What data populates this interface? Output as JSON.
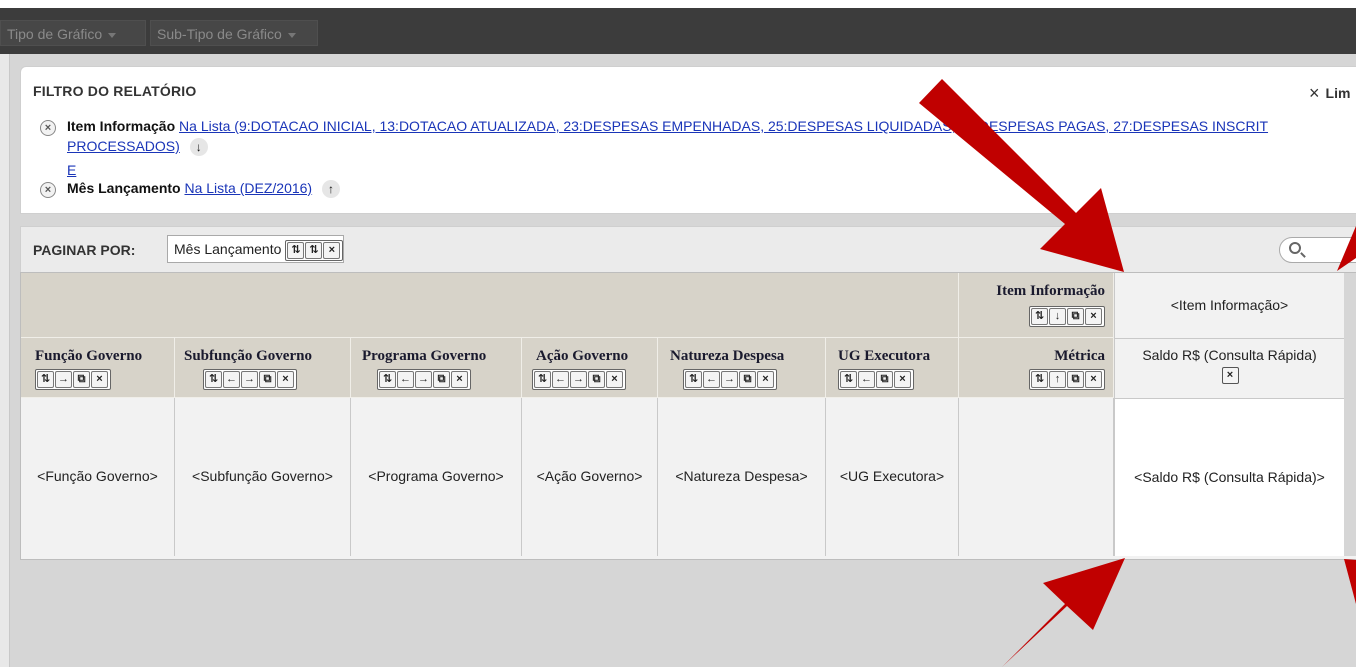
{
  "toolbar": {
    "chart_type": "Tipo de Gráfico",
    "chart_subtype": "Sub-Tipo de Gráfico"
  },
  "filter": {
    "title": "FILTRO DO RELATÓRIO",
    "clear_label": "Lim",
    "item1_label": "Item Informação",
    "item1_value_line1": "Na Lista (9:DOTACAO INICIAL, 13:DOTACAO ATUALIZADA, 23:DESPESAS EMPENHADAS, 25:DESPESAS LIQUIDADAS, 28:DESPESAS PAGAS, 27:DESPESAS INSCRIT",
    "item1_value_line2": "PROCESSADOS)",
    "connector": "E",
    "item2_label": "Mês Lançamento",
    "item2_value": "Na Lista (DEZ/2016)"
  },
  "paging": {
    "label": "PAGINAR POR:",
    "chip": "Mês Lançamento"
  },
  "table": {
    "item_info_header": "Item Informação",
    "item_info_value": "<Item Informação>",
    "metric_header": "Métrica",
    "saldo_header": "Saldo R$ (Consulta Rápida)",
    "columns": [
      {
        "header": "Função Governo",
        "value": "<Função Governo>"
      },
      {
        "header": "Subfunção Governo",
        "value": "<Subfunção Governo>"
      },
      {
        "header": "Programa Governo",
        "value": "<Programa Governo>"
      },
      {
        "header": "Ação Governo",
        "value": "<Ação Governo>"
      },
      {
        "header": "Natureza Despesa",
        "value": "<Natureza Despesa>"
      },
      {
        "header": "UG Executora",
        "value": "<UG Executora>"
      }
    ],
    "saldo_value": "<Saldo R$ (Consulta Rápida)>"
  },
  "icons": {
    "remove": "×",
    "down_arrow": "↓",
    "up_arrow": "↑",
    "pivot": "⇅",
    "move_left": "←",
    "move_right": "→",
    "window": "⧉",
    "close": "×"
  },
  "colors": {
    "toolbar_bg": "#3c3c3c",
    "header_bg": "#d7d3c9",
    "link": "#1a35b8",
    "annotation_arrow": "#c00000"
  }
}
